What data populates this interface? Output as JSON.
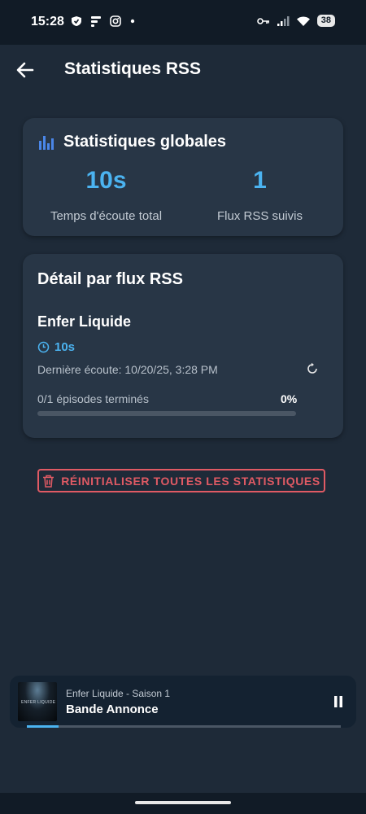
{
  "status_bar": {
    "time": "15:28",
    "battery": "38",
    "icons_left": [
      "shield-icon",
      "f-app-icon",
      "instagram-icon",
      "dot-icon"
    ],
    "icons_right": [
      "key-icon",
      "signal-icon",
      "wifi-icon",
      "battery-icon"
    ]
  },
  "header": {
    "title": "Statistiques RSS",
    "back_icon": "arrow-left-icon"
  },
  "global_stats": {
    "icon": "bar-chart-icon",
    "title": "Statistiques globales",
    "total_listen_value": "10s",
    "total_listen_label": "Temps d'écoute total",
    "feeds_value": "1",
    "feeds_label": "Flux RSS suivis"
  },
  "feed_detail": {
    "title": "Détail par flux RSS",
    "feeds": [
      {
        "name": "Enfer Liquide",
        "listen_time": "10s",
        "last_listen": "Dernière écoute: 10/20/25, 3:28 PM",
        "episodes_done": "0/1 épisodes terminés",
        "percent": "0%",
        "progress_fraction": 0
      }
    ]
  },
  "reset_button": {
    "label": "RÉINITIALISER TOUTES LES STATISTIQUES",
    "icon": "trash-icon"
  },
  "mini_player": {
    "artwork_text": "ENFER LIQUIDE",
    "subtitle": "Enfer Liquide - Saison 1",
    "title": "Bande Annonce",
    "progress_fraction": 0.1
  },
  "colors": {
    "accent": "#4bb3f0",
    "danger": "#e05a64",
    "background": "#1e2a38",
    "card": "#283646"
  }
}
